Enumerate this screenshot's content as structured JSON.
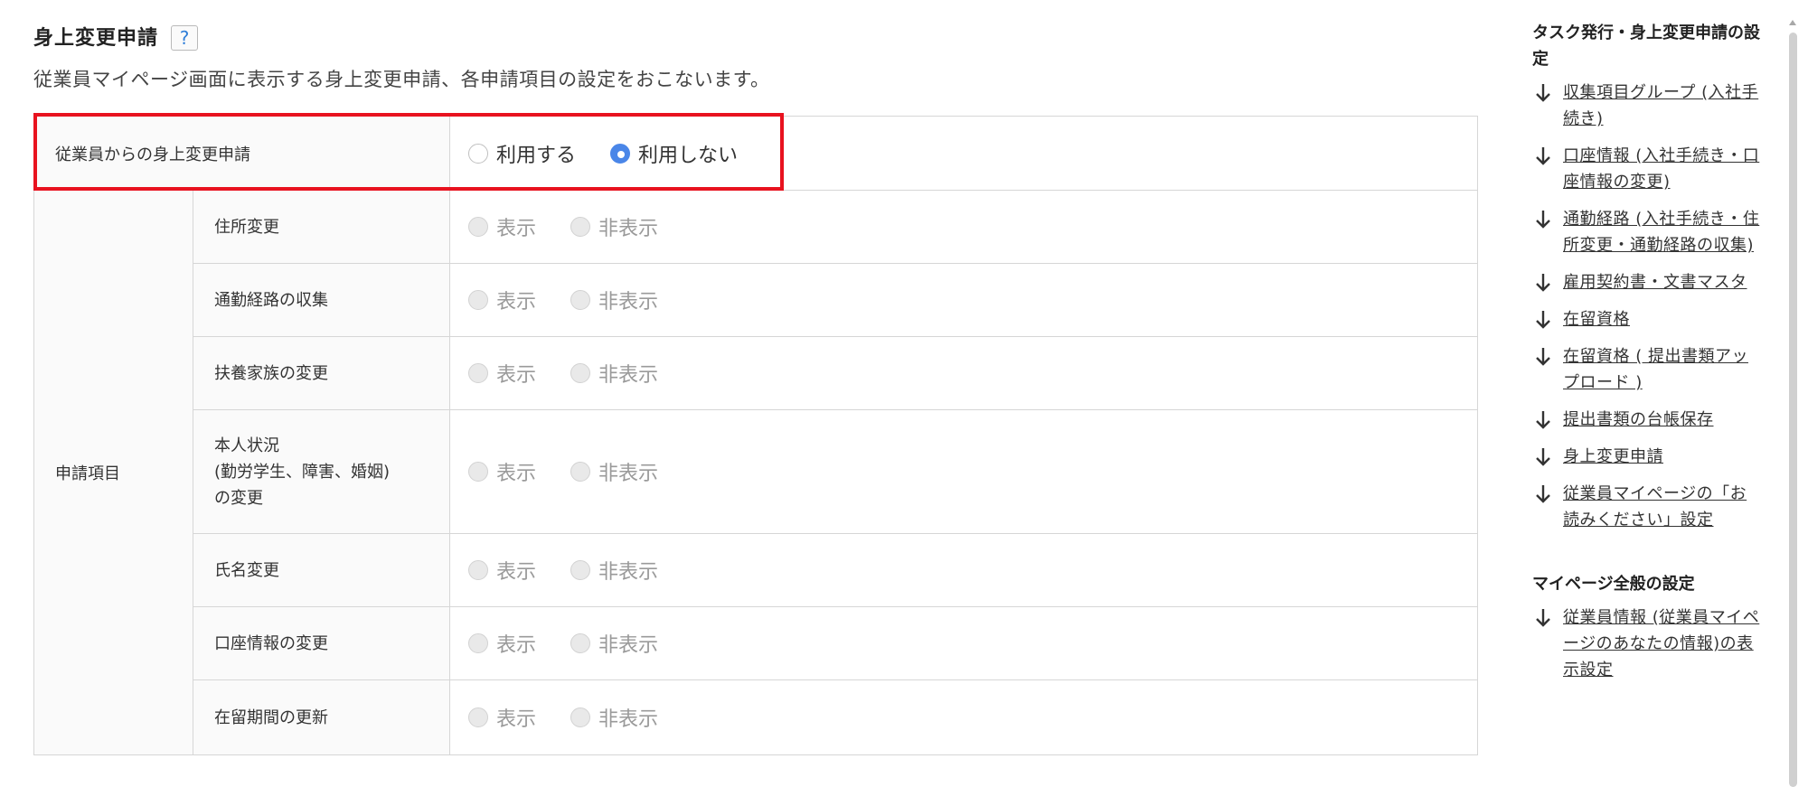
{
  "header": {
    "title": "身上変更申請",
    "help_label": "?",
    "description": "従業員マイページ画面に表示する身上変更申請、各申請項目の設定をおこないます。"
  },
  "table": {
    "employee_request": {
      "label": "従業員からの身上変更申請",
      "options": [
        {
          "label": "利用する",
          "checked": false
        },
        {
          "label": "利用しない",
          "checked": true
        }
      ]
    },
    "items_label": "申請項目",
    "show_label": "表示",
    "hide_label": "非表示",
    "items": [
      {
        "name": "住所変更"
      },
      {
        "name": "通勤経路の収集"
      },
      {
        "name": "扶養家族の変更"
      },
      {
        "name_lines": [
          "本人状況",
          "(勤労学生、障害、婚姻)",
          "の変更"
        ]
      },
      {
        "name": "氏名変更"
      },
      {
        "name": "口座情報の変更"
      },
      {
        "name": "在留期間の更新"
      }
    ]
  },
  "sidebar": {
    "heading1": "タスク発行・身上変更申請の設定",
    "links1": [
      "収集項目グループ (入社手続き)",
      "口座情報 (入社手続き・口座情報の変更)",
      "通勤経路 (入社手続き・住所変更・通勤経路の収集)",
      "雇用契約書・文書マスタ",
      "在留資格",
      "在留資格 ( 提出書類アップロード )",
      "提出書類の台帳保存",
      "身上変更申請",
      "従業員マイページの「お読みください」設定"
    ],
    "heading2": "マイページ全般の設定",
    "links2": [
      "従業員情報 (従業員マイページのあなたの情報)の表示設定"
    ]
  },
  "colors": {
    "highlight": "#e8121f",
    "radio_checked": "#4a86e8",
    "help_icon": "#2f7ed8"
  },
  "icons": {
    "sidebar_link": "arrow-down-icon",
    "help": "question-mark-icon"
  }
}
